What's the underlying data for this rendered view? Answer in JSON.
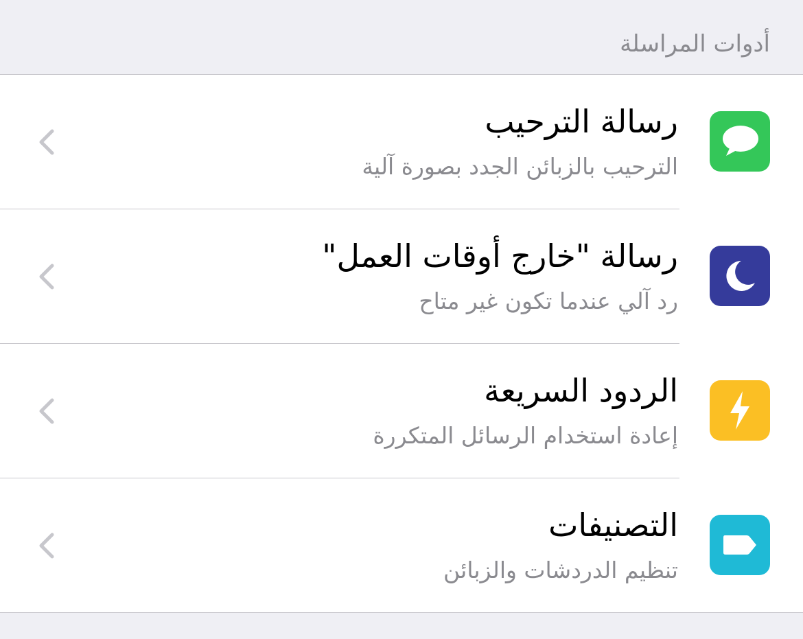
{
  "section": {
    "title": "أدوات المراسلة"
  },
  "rows": [
    {
      "title": "رسالة الترحيب",
      "subtitle": "الترحيب بالزبائن الجدد بصورة آلية",
      "icon": "chat-bubble-icon",
      "color": "#34c759"
    },
    {
      "title": "رسالة \"خارج أوقات العمل\"",
      "subtitle": "رد آلي عندما تكون غير متاح",
      "icon": "moon-icon",
      "color": "#353b9b"
    },
    {
      "title": "الردود السريعة",
      "subtitle": "إعادة استخدام الرسائل المتكررة",
      "icon": "lightning-icon",
      "color": "#fbbf24"
    },
    {
      "title": "التصنيفات",
      "subtitle": "تنظيم الدردشات والزبائن",
      "icon": "label-tag-icon",
      "color": "#1fbad6"
    }
  ],
  "colors": {
    "background": "#efeff4",
    "separator": "#c8c7cc",
    "secondary_text": "#8a8a8f",
    "chevron": "#c7c7cc"
  }
}
